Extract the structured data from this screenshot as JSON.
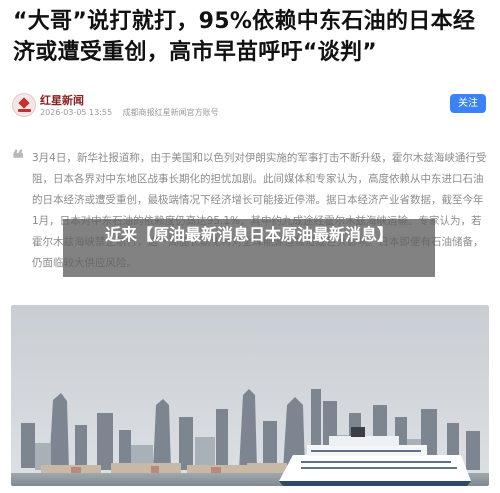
{
  "headline": "“大哥”说打就打，95%依赖中东石油的日本经济或遭受重创，高市早苗呼吁“谈判”",
  "source": {
    "name": "红星新闻",
    "time": "2026-03-05 13:55",
    "description": "成都商报红星新闻官方账号",
    "follow_label": "关注"
  },
  "quote_icon": "quote-icon",
  "body_text": "3月4日，新华社报道称，由于美国和以色列对伊朗实施的军事打击不断升级，霍尔木兹海峡通行受阻，日本各界对中东地区战事长期化的担忧加剧。此间媒体和专家认为，高度依赖从中东进口石油的日本经济或遭受重创，最极端情况下经济增长可能接近停滞。据日本经济产业省数据，截至今年1月，日本对中东石油的依赖度仍高达95.1%，其中约九成途经霍尔木兹海峡运输。专家认为，若霍尔木兹海峡禁止航行，这一局面长期化将对全球能源运输造成巨大影响。日本即便有石油储备，仍面临较大供应风险。",
  "overlay_banner": "近来【原油最新消息日本原油最新消息】",
  "photo": {
    "description_icon": "city-skyline-with-cruise-ship-image"
  }
}
